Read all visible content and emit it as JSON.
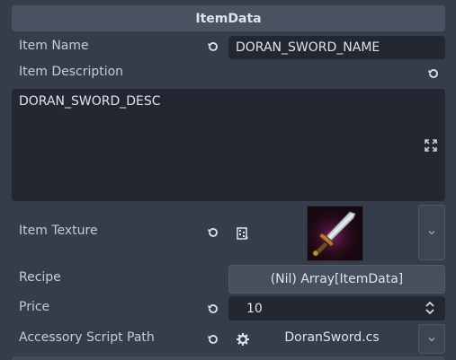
{
  "header": {
    "title": "ItemData"
  },
  "item_name": {
    "label": "Item Name",
    "value": "DORAN_SWORD_NAME"
  },
  "item_description": {
    "label": "Item Description",
    "value": "DORAN_SWORD_DESC"
  },
  "item_texture": {
    "label": "Item Texture"
  },
  "recipe": {
    "label": "Recipe",
    "value": "(Nil) Array[ItemData]"
  },
  "price": {
    "label": "Price",
    "value": "10"
  },
  "accessory_script": {
    "label": "Accessory Script Path",
    "value": "DoranSword.cs"
  },
  "icons": {
    "revert": "revert-icon",
    "expand": "expand-icon",
    "texture_resource": "texture-resource-icon",
    "script": "gear-script-icon",
    "dropdown": "chevron-down-icon",
    "spinner": "spinner-arrows-icon"
  },
  "colors": {
    "panel_bg": "#363d4a",
    "field_bg": "#222731",
    "header_bg": "#4a5160"
  }
}
